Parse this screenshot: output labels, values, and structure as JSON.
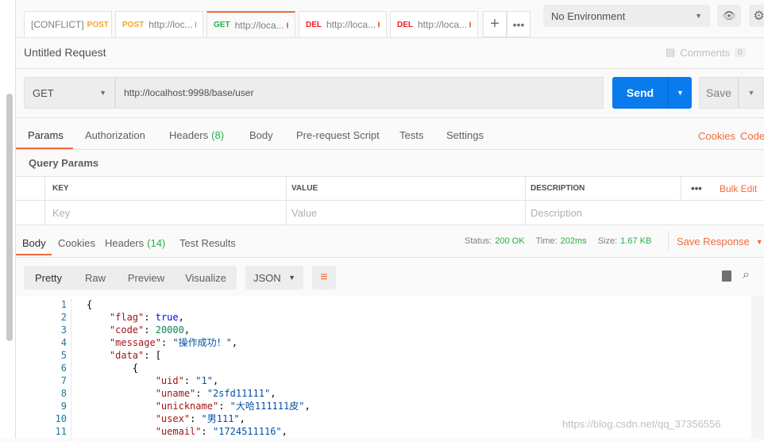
{
  "tabs": [
    {
      "prefix": "[CONFLICT]",
      "method": "POST",
      "method_color": "#f5a623",
      "url": ""
    },
    {
      "prefix": "",
      "method": "POST",
      "method_color": "#f5a623",
      "url": "http://loc..."
    },
    {
      "prefix": "",
      "method": "GET",
      "method_color": "#26b047",
      "url": "http://loca..."
    },
    {
      "prefix": "",
      "method": "DEL",
      "method_color": "#ed1c24",
      "url": "http://loca..."
    },
    {
      "prefix": "",
      "method": "DEL",
      "method_color": "#ed1c24",
      "url": "http://loca..."
    }
  ],
  "environment": "No Environment",
  "request_title": "Untitled Request",
  "comments": {
    "label": "Comments",
    "count": "0"
  },
  "method": "GET",
  "url": "http://localhost:9998/base/user",
  "send_label": "Send",
  "save_label": "Save",
  "request_tabs": [
    {
      "label": "Params"
    },
    {
      "label": "Authorization"
    },
    {
      "label": "Headers",
      "count": "(8)"
    },
    {
      "label": "Body"
    },
    {
      "label": "Pre-request Script"
    },
    {
      "label": "Tests"
    },
    {
      "label": "Settings"
    }
  ],
  "cookies_link": "Cookies",
  "code_link": "Code",
  "query_params_title": "Query Params",
  "params_table": {
    "headers": [
      "KEY",
      "VALUE",
      "DESCRIPTION"
    ],
    "placeholders": [
      "Key",
      "Value",
      "Description"
    ],
    "bulk_edit": "Bulk Edit"
  },
  "response_tabs": [
    {
      "label": "Body"
    },
    {
      "label": "Cookies"
    },
    {
      "label": "Headers",
      "count": "(14)"
    },
    {
      "label": "Test Results"
    }
  ],
  "status": {
    "status_label": "Status:",
    "status": "200 OK",
    "time_label": "Time:",
    "time": "202ms",
    "size_label": "Size:",
    "size": "1.67 KB"
  },
  "save_response": "Save Response",
  "view_modes": [
    "Pretty",
    "Raw",
    "Preview",
    "Visualize"
  ],
  "format": "JSON",
  "code_lines": [
    [
      [
        "p",
        "{"
      ]
    ],
    [
      [
        "p",
        "    "
      ],
      [
        "k",
        "\"flag\""
      ],
      [
        "p",
        ": "
      ],
      [
        "b",
        "true"
      ],
      [
        "p",
        ","
      ]
    ],
    [
      [
        "p",
        "    "
      ],
      [
        "k",
        "\"code\""
      ],
      [
        "p",
        ": "
      ],
      [
        "n",
        "20000"
      ],
      [
        "p",
        ","
      ]
    ],
    [
      [
        "p",
        "    "
      ],
      [
        "k",
        "\"message\""
      ],
      [
        "p",
        ": "
      ],
      [
        "s",
        "\"操作成功！\""
      ],
      [
        "p",
        ","
      ]
    ],
    [
      [
        "p",
        "    "
      ],
      [
        "k",
        "\"data\""
      ],
      [
        "p",
        ": ["
      ]
    ],
    [
      [
        "p",
        "        {"
      ]
    ],
    [
      [
        "p",
        "            "
      ],
      [
        "k",
        "\"uid\""
      ],
      [
        "p",
        ": "
      ],
      [
        "s",
        "\"1\""
      ],
      [
        "p",
        ","
      ]
    ],
    [
      [
        "p",
        "            "
      ],
      [
        "k",
        "\"uname\""
      ],
      [
        "p",
        ": "
      ],
      [
        "s",
        "\"2sfd11111\""
      ],
      [
        "p",
        ","
      ]
    ],
    [
      [
        "p",
        "            "
      ],
      [
        "k",
        "\"unickname\""
      ],
      [
        "p",
        ": "
      ],
      [
        "s",
        "\"大哈111111皮\""
      ],
      [
        "p",
        ","
      ]
    ],
    [
      [
        "p",
        "            "
      ],
      [
        "k",
        "\"usex\""
      ],
      [
        "p",
        ": "
      ],
      [
        "s",
        "\"男111\""
      ],
      [
        "p",
        ","
      ]
    ],
    [
      [
        "p",
        "            "
      ],
      [
        "k",
        "\"uemail\""
      ],
      [
        "p",
        ": "
      ],
      [
        "s",
        "\"1724511116\""
      ],
      [
        "p",
        ","
      ]
    ]
  ],
  "watermark": "https://blog.csdn.net/qq_37356556"
}
